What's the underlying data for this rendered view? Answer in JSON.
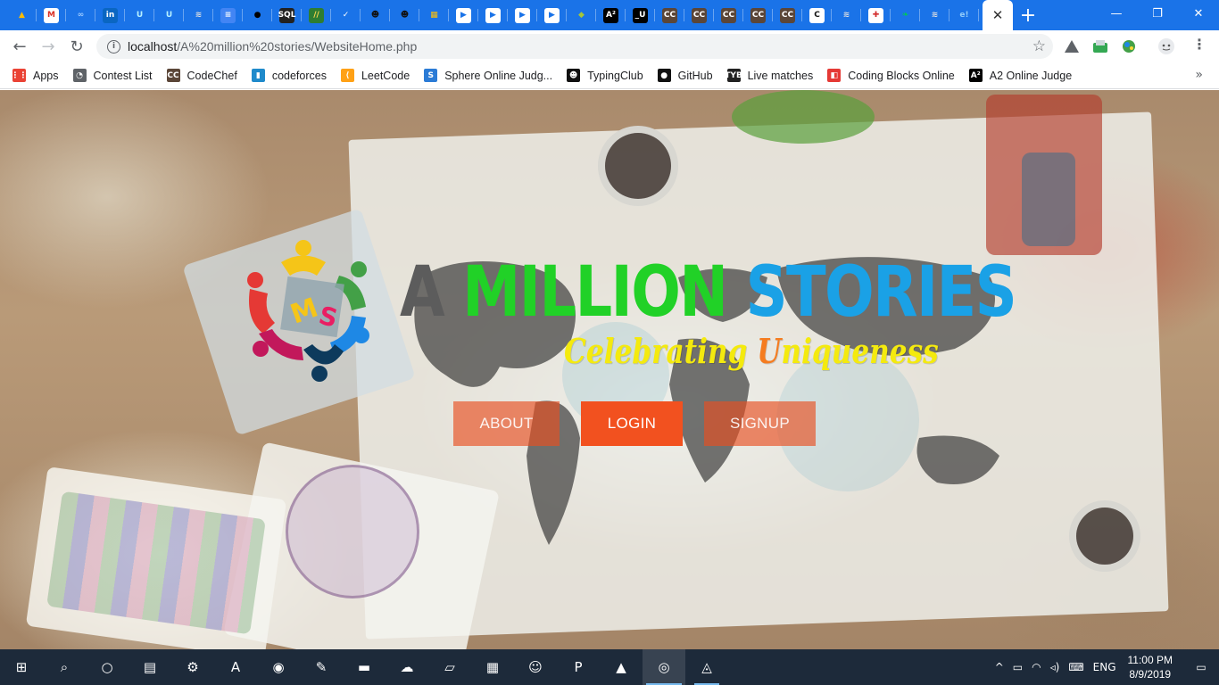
{
  "browser": {
    "tabs": [
      {
        "icon": "google-drive-icon",
        "glyph": "▲",
        "color": "#1a73e8",
        "fg": "#fbbc04"
      },
      {
        "icon": "gmail-icon",
        "glyph": "M",
        "color": "#ffffff",
        "fg": "#d93025"
      },
      {
        "icon": "infinity-icon",
        "glyph": "∞",
        "color": "#1a73e8",
        "fg": "#9ecbff"
      },
      {
        "icon": "linkedin-icon",
        "glyph": "in",
        "color": "#0a66c2",
        "fg": "#ffffff"
      },
      {
        "icon": "udemy-icon",
        "glyph": "U",
        "color": "#1a73e8",
        "fg": "#b6f0ff"
      },
      {
        "icon": "udemy-icon",
        "glyph": "U",
        "color": "#1a73e8",
        "fg": "#b6f0ff"
      },
      {
        "icon": "stack-icon",
        "glyph": "≋",
        "color": "#1a73e8",
        "fg": "#e0e0e0"
      },
      {
        "icon": "docs-icon",
        "glyph": "≡",
        "color": "#4285f4",
        "fg": "#ffffff"
      },
      {
        "icon": "github-icon",
        "glyph": "●",
        "color": "#1a73e8",
        "fg": "#000000"
      },
      {
        "icon": "sql-icon",
        "glyph": "SQL",
        "color": "#222222",
        "fg": "#ffffff"
      },
      {
        "icon": "hackerearth-icon",
        "glyph": "//",
        "color": "#2e7d32",
        "fg": "#ffd54f"
      },
      {
        "icon": "check-icon",
        "glyph": "✓",
        "color": "#1a73e8",
        "fg": "#ffffff"
      },
      {
        "icon": "ninja-icon",
        "glyph": "☻",
        "color": "#1a73e8",
        "fg": "#111111"
      },
      {
        "icon": "ninja-icon",
        "glyph": "☻",
        "color": "#1a73e8",
        "fg": "#111111"
      },
      {
        "icon": "windows-icon",
        "glyph": "▦",
        "color": "#1a73e8",
        "fg": "#ffc107"
      },
      {
        "icon": "play-icon",
        "glyph": "▶",
        "color": "#ffffff",
        "fg": "#1a73e8"
      },
      {
        "icon": "play-icon",
        "glyph": "▶",
        "color": "#ffffff",
        "fg": "#1a73e8"
      },
      {
        "icon": "play-icon",
        "glyph": "▶",
        "color": "#ffffff",
        "fg": "#1a73e8"
      },
      {
        "icon": "play-icon",
        "glyph": "▶",
        "color": "#ffffff",
        "fg": "#1a73e8"
      },
      {
        "icon": "android-icon",
        "glyph": "◆",
        "color": "#1a73e8",
        "fg": "#a4c639"
      },
      {
        "icon": "a2-icon",
        "glyph": "A²",
        "color": "#000000",
        "fg": "#ffffff"
      },
      {
        "icon": "terminal-icon",
        "glyph": "_U",
        "color": "#000000",
        "fg": "#ffffff"
      },
      {
        "icon": "codechef-icon",
        "glyph": "CC",
        "color": "#5b4638",
        "fg": "#ffffff"
      },
      {
        "icon": "codechef-icon",
        "glyph": "CC",
        "color": "#5b4638",
        "fg": "#ffffff"
      },
      {
        "icon": "codechef-icon",
        "glyph": "CC",
        "color": "#5b4638",
        "fg": "#ffffff"
      },
      {
        "icon": "codechef-icon",
        "glyph": "CC",
        "color": "#5b4638",
        "fg": "#ffffff"
      },
      {
        "icon": "codechef-icon",
        "glyph": "CC",
        "color": "#5b4638",
        "fg": "#ffffff"
      },
      {
        "icon": "c-icon",
        "glyph": "C",
        "color": "#ffffff",
        "fg": "#111111"
      },
      {
        "icon": "stack-icon",
        "glyph": "≋",
        "color": "#1a73e8",
        "fg": "#e0e0e0"
      },
      {
        "icon": "plus-cross-icon",
        "glyph": "✚",
        "color": "#ffffff",
        "fg": "#d32f2f"
      },
      {
        "icon": "leaf-icon",
        "glyph": "❧",
        "color": "#1a73e8",
        "fg": "#00c853"
      },
      {
        "icon": "stack-icon",
        "glyph": "≋",
        "color": "#1a73e8",
        "fg": "#e0e0e0"
      },
      {
        "icon": "edge-e-icon",
        "glyph": "e!",
        "color": "#1a73e8",
        "fg": "#90caf9"
      }
    ],
    "active_tab_close": "✕",
    "new_tab": "+",
    "window": {
      "minimize": "—",
      "restore": "❐",
      "close": "✕"
    },
    "nav": {
      "back": "←",
      "forward": "→",
      "reload": "↻"
    },
    "url_host": "localhost",
    "url_path": "/A%20million%20stories/WebsiteHome.php",
    "star": "☆",
    "menu": "⋮"
  },
  "bookmarks": {
    "items": [
      {
        "label": "Apps",
        "icon": "apps-grid-icon",
        "color": "#ea4335",
        "glyph": "⋮⋮"
      },
      {
        "label": "Contest List",
        "icon": "globe-icon",
        "color": "#5f6368",
        "glyph": "◔"
      },
      {
        "label": "CodeChef",
        "icon": "codechef-icon",
        "color": "#5b4638",
        "glyph": "CC"
      },
      {
        "label": "codeforces",
        "icon": "codeforces-icon",
        "color": "#1f8acb",
        "glyph": "▮"
      },
      {
        "label": "LeetCode",
        "icon": "leetcode-icon",
        "color": "#ffa116",
        "glyph": "⟨"
      },
      {
        "label": "Sphere Online Judg...",
        "icon": "spoj-icon",
        "color": "#2b7bd6",
        "glyph": "S"
      },
      {
        "label": "TypingClub",
        "icon": "ninja-icon",
        "color": "#111111",
        "glyph": "☻"
      },
      {
        "label": "GitHub",
        "icon": "github-icon",
        "color": "#111111",
        "glyph": "●"
      },
      {
        "label": "Live matches",
        "icon": "tyb-icon",
        "color": "#222222",
        "glyph": "TYB"
      },
      {
        "label": "Coding Blocks Online",
        "icon": "coding-blocks-icon",
        "color": "#e53935",
        "glyph": "◧"
      },
      {
        "label": "A2 Online Judge",
        "icon": "a2-icon",
        "color": "#000000",
        "glyph": "A²"
      }
    ],
    "more": "»"
  },
  "site": {
    "title_w1": "A",
    "title_w2": "MILLION",
    "title_w3": "STORIES",
    "tagline_a": "Celebrating ",
    "tagline_u": "U",
    "tagline_b": "niqueness",
    "buttons": {
      "about": "ABOUT",
      "login": "LOGIN",
      "signup": "SIGNUP"
    },
    "colors": {
      "accent": "#f2511f",
      "green": "#21d127",
      "blue": "#1aa1e6",
      "yellow": "#f4ea0e"
    }
  },
  "taskbar": {
    "apps": [
      {
        "icon": "windows-start-icon",
        "glyph": "⊞"
      },
      {
        "icon": "search-icon",
        "glyph": "⌕"
      },
      {
        "icon": "cortana-icon",
        "glyph": "○"
      },
      {
        "icon": "task-view-icon",
        "glyph": "▤"
      },
      {
        "icon": "settings-gear-icon",
        "glyph": "⚙"
      },
      {
        "icon": "acrobat-icon",
        "glyph": "A"
      },
      {
        "icon": "record-icon",
        "glyph": "◉"
      },
      {
        "icon": "paint-icon",
        "glyph": "✎"
      },
      {
        "icon": "file-explorer-icon",
        "glyph": "▬"
      },
      {
        "icon": "cloud-upload-icon",
        "glyph": "☁"
      },
      {
        "icon": "notes-icon",
        "glyph": "▱"
      },
      {
        "icon": "calculator-icon",
        "glyph": "▦"
      },
      {
        "icon": "cat-app-icon",
        "glyph": "☺"
      },
      {
        "icon": "p-app-icon",
        "glyph": "P"
      },
      {
        "icon": "vlc-icon",
        "glyph": "▲"
      },
      {
        "icon": "chrome-icon",
        "glyph": "◎"
      },
      {
        "icon": "android-studio-icon",
        "glyph": "◬"
      }
    ],
    "tray": {
      "chevron": "^",
      "battery": "▭",
      "wifi": "◠",
      "volume": "◃)",
      "keyboard": "⌨",
      "lang": "ENG"
    },
    "time": "11:00 PM",
    "date": "8/9/2019",
    "notifications": "▭"
  }
}
